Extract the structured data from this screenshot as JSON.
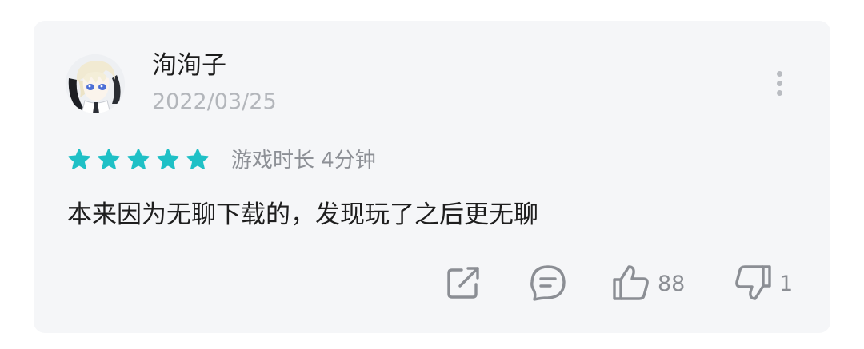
{
  "review": {
    "username": "洵洵子",
    "date": "2022/03/25",
    "rating": 5,
    "rating_max": 5,
    "star_color": "#1fc0c6",
    "playtime": "游戏时长 4分钟",
    "text": "本来因为无聊下载的，发现玩了之后更无聊",
    "actions": {
      "share_icon": "share-icon",
      "comment_icon": "comment-icon",
      "like_icon": "thumbs-up-icon",
      "like_count": "88",
      "dislike_icon": "thumbs-down-icon",
      "dislike_count": "1"
    },
    "more_icon": "more-vertical-icon"
  }
}
